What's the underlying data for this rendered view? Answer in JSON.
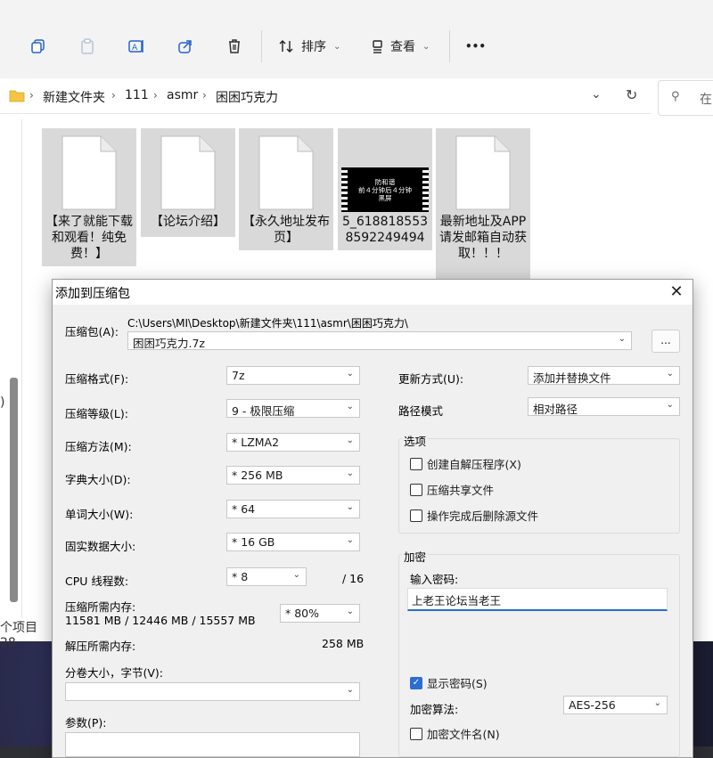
{
  "toolbar": {
    "sort_label": "排序",
    "view_label": "查看",
    "more_label": "•••"
  },
  "breadcrumb": [
    "新建文件夹",
    "111",
    "asmr",
    "困困巧克力"
  ],
  "search": {
    "placeholder": "在"
  },
  "files": [
    {
      "name": "【来了就能下载和观看！纯免费！】",
      "kind": "doc"
    },
    {
      "name": "【论坛介绍】",
      "kind": "doc"
    },
    {
      "name": "【永久地址发布页】",
      "kind": "doc"
    },
    {
      "name": "5_6188185538592249494",
      "kind": "video",
      "thumb_line1": "防和谐",
      "thumb_line2": "前４分钟后４分钟",
      "thumb_line3": "黑屏"
    },
    {
      "name": "最新地址及APP请发邮箱自动获取！！！",
      "kind": "doc"
    }
  ],
  "status": {
    "items_text": "个项目  28"
  },
  "left_edge_glyph": ")",
  "dialog": {
    "title": "添加到压缩包",
    "close_glyph": "✕",
    "archive_label": "压缩包(A):",
    "archive_path": "C:\\Users\\MI\\Desktop\\新建文件夹\\111\\asmr\\困困巧克力\\",
    "archive_name": "困困巧克力.7z",
    "browse_label": "...",
    "format_label": "压缩格式(F):",
    "format_value": "7z",
    "level_label": "压缩等级(L):",
    "level_value": "9 - 极限压缩",
    "method_label": "压缩方法(M):",
    "method_value": "*  LZMA2",
    "dict_label": "字典大小(D):",
    "dict_value": "*  256 MB",
    "word_label": "单词大小(W):",
    "word_value": "*  64",
    "solid_label": "固实数据大小:",
    "solid_value": "*  16 GB",
    "cpu_label": "CPU 线程数:",
    "cpu_value": "*  8",
    "cpu_total": "/ 16",
    "mem_label": "压缩所需内存:",
    "mem_values": "11581 MB / 12446 MB / 15557 MB",
    "mem_percent": "*  80%",
    "decomp_label": "解压所需内存:",
    "decomp_value": "258 MB",
    "split_label": "分卷大小，字节(V):",
    "split_value": "",
    "params_label": "参数(P):",
    "update_label": "更新方式(U):",
    "update_value": "添加并替换文件",
    "path_label": "路径模式",
    "path_value": "相对路径",
    "options_title": "选项",
    "opt_sfx": "创建自解压程序(X)",
    "opt_shared": "压缩共享文件",
    "opt_delete": "操作完成后删除源文件",
    "encrypt_title": "加密",
    "password_label": "输入密码:",
    "password_value": "上老王论坛当老王",
    "show_password": "显示密码(S)",
    "enc_method_label": "加密算法:",
    "enc_method_value": "AES-256",
    "enc_names": "加密文件名(N)"
  },
  "colors": {
    "accent": "#2b6dd2",
    "file_selected_bg": "#d9d9d9"
  }
}
